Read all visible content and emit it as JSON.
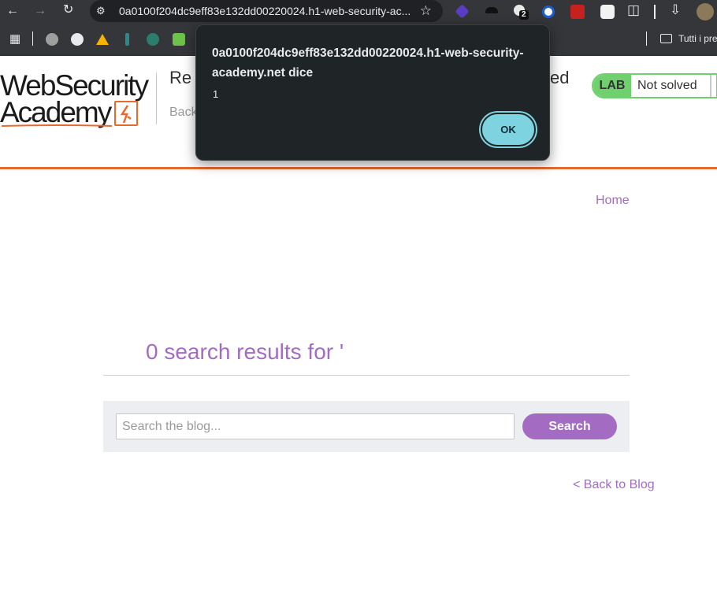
{
  "browser": {
    "url": "0a0100f204dc9eff83e132dd00220024.h1-web-security-ac...",
    "extension_badge": "2",
    "bookmark_folder": "Tutti i pre"
  },
  "header": {
    "logo_line1": "WebSecurity",
    "logo_line2": "Academy",
    "lab_title_start": "Re",
    "lab_title_end": "ed",
    "back_link": "Back",
    "lab_badge": "LAB",
    "lab_status": "Not solved"
  },
  "nav": {
    "home": "Home"
  },
  "main": {
    "results_heading": "0 search results for '",
    "search_placeholder": "Search the blog...",
    "search_button": "Search",
    "back_to_blog": "< Back to Blog"
  },
  "alert": {
    "origin": "0a0100f204dc9eff83e132dd00220024.h1-web-security-academy.net dice",
    "message": "1",
    "ok_label": "OK"
  },
  "colors": {
    "accent_purple": "#a36cc2",
    "brand_orange": "#e8692f",
    "lab_green": "#70d06f",
    "dialog_ok": "#7ed3e1"
  }
}
